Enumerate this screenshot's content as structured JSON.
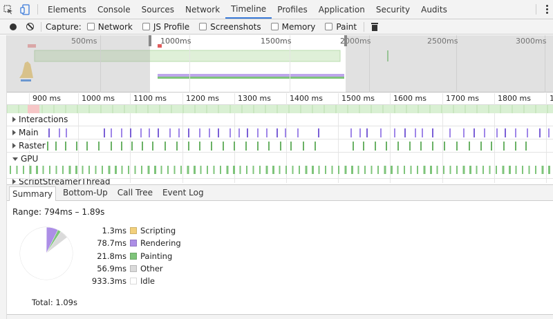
{
  "tabs": [
    "Elements",
    "Console",
    "Sources",
    "Network",
    "Timeline",
    "Profiles",
    "Application",
    "Security",
    "Audits"
  ],
  "active_tab": "Timeline",
  "capture": {
    "label": "Capture:",
    "options": [
      "Network",
      "JS Profile",
      "Screenshots",
      "Memory",
      "Paint"
    ]
  },
  "overview_ticks": [
    "500ms",
    "1000ms",
    "1500ms",
    "2000ms",
    "2500ms",
    "3000ms"
  ],
  "ruler_ticks": [
    "900 ms",
    "1000 ms",
    "1100 ms",
    "1200 ms",
    "1300 ms",
    "1400 ms",
    "1500 ms",
    "1600 ms",
    "1700 ms",
    "1800 ms",
    "1"
  ],
  "tracks": {
    "interactions": "Interactions",
    "main": "Main",
    "raster": "Raster",
    "gpu": "GPU",
    "script_streamer": "ScriptStreamerThread"
  },
  "detail_tabs": [
    "Summary",
    "Bottom-Up",
    "Call Tree",
    "Event Log"
  ],
  "active_detail_tab": "Summary",
  "summary": {
    "range": "Range: 794ms – 1.89s",
    "total": "Total: 1.09s"
  },
  "colors": {
    "scripting": "#f2d07c",
    "rendering": "#ac8ee6",
    "painting": "#7ec47a",
    "other": "#dadada",
    "idle": "#ffffff",
    "accent": "#3879d9"
  },
  "chart_data": {
    "type": "pie",
    "unit": "ms",
    "series": [
      {
        "name": "Scripting",
        "value": 1.3,
        "label": "1.3ms"
      },
      {
        "name": "Rendering",
        "value": 78.7,
        "label": "78.7ms"
      },
      {
        "name": "Painting",
        "value": 21.8,
        "label": "21.8ms"
      },
      {
        "name": "Other",
        "value": 56.9,
        "label": "56.9ms"
      },
      {
        "name": "Idle",
        "value": 933.3,
        "label": "933.3ms"
      }
    ]
  }
}
